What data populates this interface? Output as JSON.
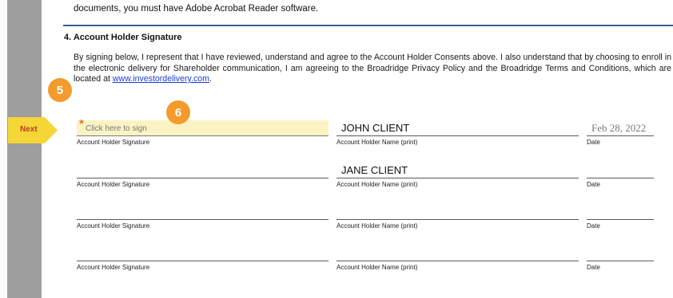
{
  "document": {
    "top_line": "documents, you must have Adobe Acrobat Reader software.",
    "section_title": "4.  Account Holder Signature",
    "paragraph_text": "By signing below, I represent that I have reviewed, understand and agree to the Account Holder Consents above. I also understand that by choosing to enroll in the electronic delivery for Shareholder communication, I am agreeing to the Broadridge Privacy Policy and the Broadridge Terms and Conditions, which are located at",
    "link_text": "www.investordelivery.com",
    "paragraph_end": "."
  },
  "signature_rows": [
    {
      "sign_placeholder": "Click here to sign",
      "sign_label": "Account Holder Signature",
      "name_value": "JOHN CLIENT",
      "name_label": "Account Holder Name (print)",
      "date_value": "Feb 28, 2022",
      "date_label": "Date"
    },
    {
      "sign_label": "Account Holder Signature",
      "name_value": "JANE CLIENT",
      "name_label": "Account Holder Name (print)",
      "date_value": "",
      "date_label": "Date"
    },
    {
      "sign_label": "Account Holder Signature",
      "name_value": "",
      "name_label": "Account Holder Name (print)",
      "date_value": "",
      "date_label": "Date"
    },
    {
      "sign_label": "Account Holder Signature",
      "name_value": "",
      "name_label": "Account Holder Name (print)",
      "date_value": "",
      "date_label": "Date"
    }
  ],
  "required_marker": "*",
  "next_button": {
    "label": "Next"
  },
  "callouts": {
    "step5": "5",
    "step6": "6"
  },
  "colors": {
    "sign_field_bg": "#fbf3c4",
    "next_tab": "#f4d637",
    "next_text": "#c0392b",
    "badge": "#f39b2c",
    "link": "#1a3fd1",
    "rule": "#3b5f8e"
  }
}
